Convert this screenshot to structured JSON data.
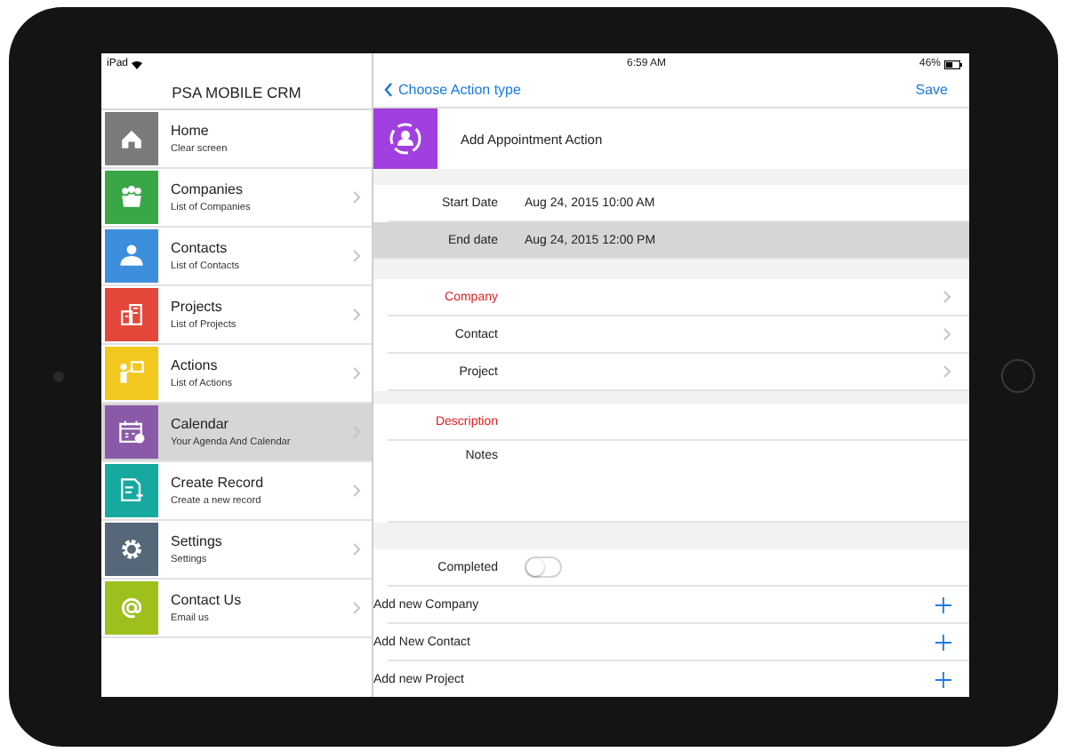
{
  "status_bar": {
    "device": "iPad",
    "time": "6:59 AM",
    "battery": "46%"
  },
  "sidebar": {
    "title": "PSA MOBILE CRM",
    "items": [
      {
        "title": "Home",
        "subtitle": "Clear screen",
        "color": "#7b7b7b",
        "selected": false,
        "chevron": false
      },
      {
        "title": "Companies",
        "subtitle": "List of Companies",
        "color": "#3aa648",
        "selected": false,
        "chevron": true
      },
      {
        "title": "Contacts",
        "subtitle": "List of Contacts",
        "color": "#3d8fde",
        "selected": false,
        "chevron": true
      },
      {
        "title": "Projects",
        "subtitle": "List of Projects",
        "color": "#e2473a",
        "selected": false,
        "chevron": true
      },
      {
        "title": "Actions",
        "subtitle": "List of Actions",
        "color": "#f2c81f",
        "selected": false,
        "chevron": true
      },
      {
        "title": "Calendar",
        "subtitle": "Your Agenda And Calendar",
        "color": "#8a5aa8",
        "selected": true,
        "chevron": true
      },
      {
        "title": "Create Record",
        "subtitle": "Create a new record",
        "color": "#17a9a0",
        "selected": false,
        "chevron": true
      },
      {
        "title": "Settings",
        "subtitle": "Settings",
        "color": "#56677a",
        "selected": false,
        "chevron": true
      },
      {
        "title": "Contact Us",
        "subtitle": "Email us",
        "color": "#9dc01c",
        "selected": false,
        "chevron": true
      }
    ]
  },
  "nav": {
    "back": "Choose Action type",
    "action": "Save"
  },
  "action_header": {
    "title": "Add Appointment Action"
  },
  "sections": [
    {
      "rows": [
        {
          "kind": "value",
          "label": "Start Date",
          "value": "Aug 24, 2015 10:00 AM",
          "selected": false
        },
        {
          "kind": "value",
          "label": "End date",
          "value": "Aug 24, 2015 12:00 PM",
          "selected": true
        }
      ]
    },
    {
      "rows": [
        {
          "kind": "link",
          "label": "Company",
          "required": true
        },
        {
          "kind": "link",
          "label": "Contact",
          "required": false
        },
        {
          "kind": "link",
          "label": "Project",
          "required": false
        }
      ]
    },
    {
      "rows": [
        {
          "kind": "text",
          "label": "Description",
          "required": true
        },
        {
          "kind": "notes",
          "label": "Notes",
          "required": false
        }
      ]
    },
    {
      "rows": [
        {
          "kind": "toggle",
          "label": "Completed",
          "on": false
        },
        {
          "kind": "add",
          "label": "Add new Company"
        },
        {
          "kind": "add",
          "label": "Add New Contact"
        },
        {
          "kind": "add",
          "label": "Add new Project"
        }
      ]
    }
  ]
}
